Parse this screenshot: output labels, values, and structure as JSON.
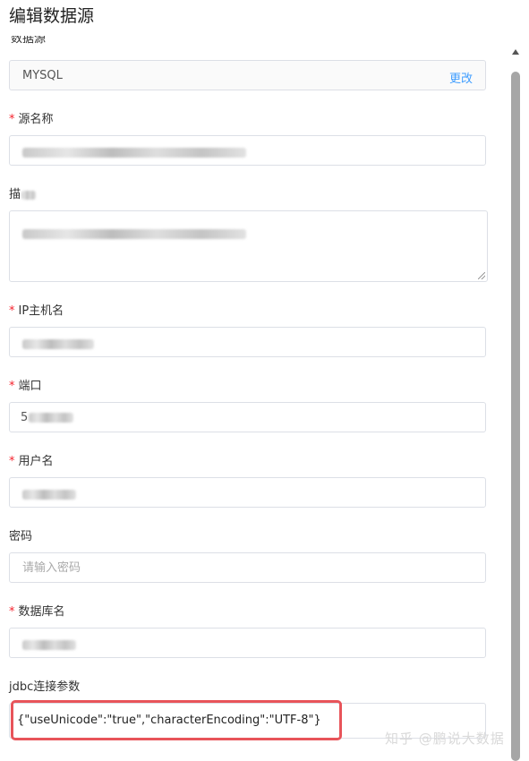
{
  "dialog": {
    "title": "编辑数据源"
  },
  "fields": {
    "datasource_type": {
      "label_fragment": "数据源",
      "value": "MYSQL",
      "change_label": "更改"
    },
    "source_name": {
      "required_mark": "*",
      "label": "源名称"
    },
    "description": {
      "label_visible": "描"
    },
    "ip_hostname": {
      "required_mark": "*",
      "label": "IP主机名"
    },
    "port": {
      "required_mark": "*",
      "label": "端口",
      "value_visible": "5"
    },
    "username": {
      "required_mark": "*",
      "label": "用户名"
    },
    "password": {
      "label": "密码",
      "placeholder": "请输入密码"
    },
    "database_name": {
      "required_mark": "*",
      "label": "数据库名"
    },
    "jdbc_params": {
      "label": "jdbc连接参数",
      "value": "{\"useUnicode\":\"true\",\"characterEncoding\":\"UTF-8\"}"
    }
  },
  "watermark": "知乎 @鹏说大数据",
  "colors": {
    "required": "#f5222d",
    "link": "#409eff",
    "highlight": "#e8545a"
  }
}
